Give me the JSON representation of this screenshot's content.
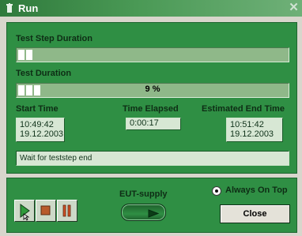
{
  "window": {
    "title": "Run",
    "close_glyph": "✕",
    "icon_name": "trash-bin-icon"
  },
  "progress": {
    "step": {
      "label": "Test Step Duration",
      "percent": 5
    },
    "test": {
      "label": "Test Duration",
      "percent": 9,
      "text": "9 %"
    }
  },
  "times": {
    "start": {
      "label": "Start Time",
      "value": "10:49:42\n19.12.2003"
    },
    "elapsed": {
      "label": "Time Elapsed",
      "value": "0:00:17"
    },
    "estimated_end": {
      "label": "Estimated End Time",
      "value": "10:51:42\n19.12.2003"
    }
  },
  "status": {
    "text": "Wait for teststep end"
  },
  "controls": {
    "eut_supply_label": "EUT-supply",
    "always_on_top_label": "Always On Top",
    "always_on_top_checked": true,
    "close_label": "Close",
    "play_icon": "play-icon",
    "stop_icon": "stop-icon",
    "pause_icon": "pause-icon"
  },
  "colors": {
    "panel_green": "#2f8f44",
    "title_green": "#2f7a3c",
    "bar_fill": "#ffffff"
  }
}
